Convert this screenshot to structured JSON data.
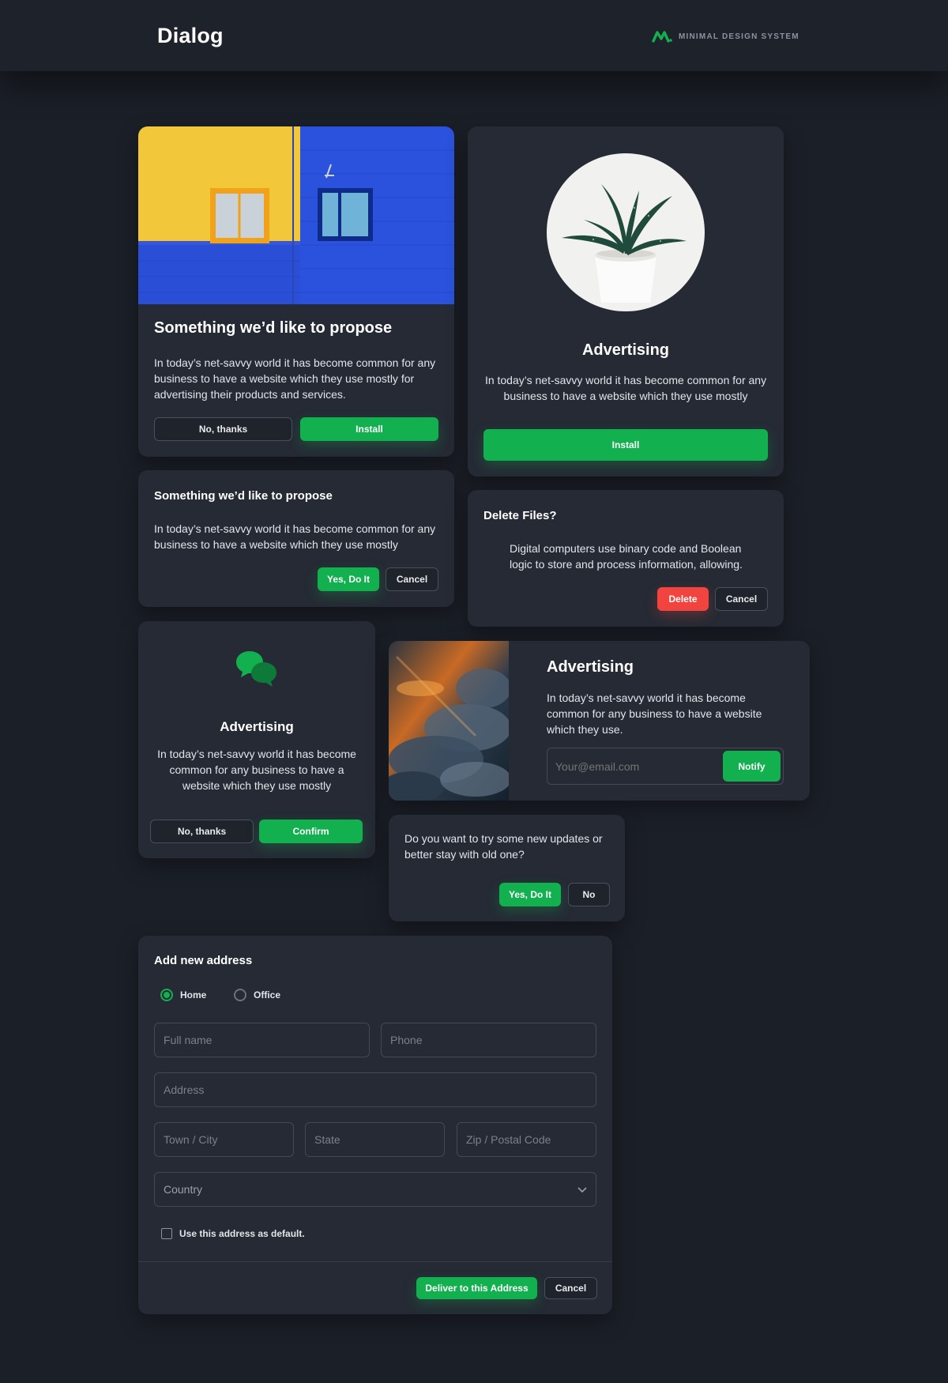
{
  "header": {
    "title": "Dialog",
    "brand_label": "MINIMAL DESIGN SYSTEM",
    "brand_icon": "m-logo-icon",
    "accent": "#12b04f"
  },
  "card1": {
    "title": "Something we’d like to propose",
    "body": "In today’s net-savvy world it has become common for any business to have a website which they use mostly for advertising their products and services.",
    "secondary_label": "No, thanks",
    "primary_label": "Install"
  },
  "card2": {
    "title": "Advertising",
    "body": "In today’s net-savvy world it has become common for any business to have a website which they use mostly",
    "primary_label": "Install"
  },
  "card3": {
    "title": "Something we’d like to propose",
    "body": "In today’s net-savvy world it has become common for any business to have a website which they use mostly",
    "primary_label": "Yes, Do It",
    "secondary_label": "Cancel"
  },
  "card4": {
    "title": "Delete Files?",
    "body": "Digital computers use binary code and Boolean logic to store and process information, allowing.",
    "danger_label": "Delete",
    "secondary_label": "Cancel",
    "danger_color": "#f2443e"
  },
  "card5": {
    "icon": "chat-bubbles-icon",
    "title": "Advertising",
    "body": "In today’s net-savvy world it has become common for any business to have a website which they use mostly",
    "secondary_label": "No, thanks",
    "primary_label": "Confirm"
  },
  "card6": {
    "title": "Advertising",
    "body": "In today’s net-savvy world it has become common for any business to have a website which they use.",
    "email_placeholder": "Your@email.com",
    "primary_label": "Notify"
  },
  "card7": {
    "body": "Do you want to try some new updates or better stay with old one?",
    "primary_label": "Yes, Do It",
    "secondary_label": "No"
  },
  "address_form": {
    "title": "Add new address",
    "radio_home": "Home",
    "radio_office": "Office",
    "selected": "Home",
    "full_name_placeholder": "Full name",
    "phone_placeholder": "Phone",
    "address_placeholder": "Address",
    "city_placeholder": "Town / City",
    "state_placeholder": "State",
    "zip_placeholder": "Zip / Postal Code",
    "country_placeholder": "Country",
    "default_checkbox_label": "Use this address as default.",
    "default_checked": false,
    "primary_label": "Deliver to this Address",
    "secondary_label": "Cancel"
  }
}
